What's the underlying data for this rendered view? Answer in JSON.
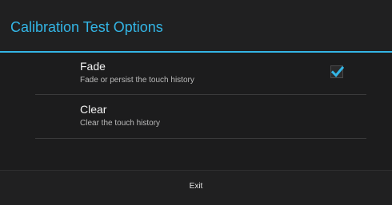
{
  "dialog": {
    "title": "Calibration Test Options",
    "accent_color": "#33b5e5",
    "options": [
      {
        "label": "Fade",
        "description": "Fade or persist the touch history",
        "checked": true,
        "icon": "checkmark-icon"
      },
      {
        "label": "Clear",
        "description": "Clear the touch history"
      }
    ],
    "exit_label": "Exit"
  }
}
